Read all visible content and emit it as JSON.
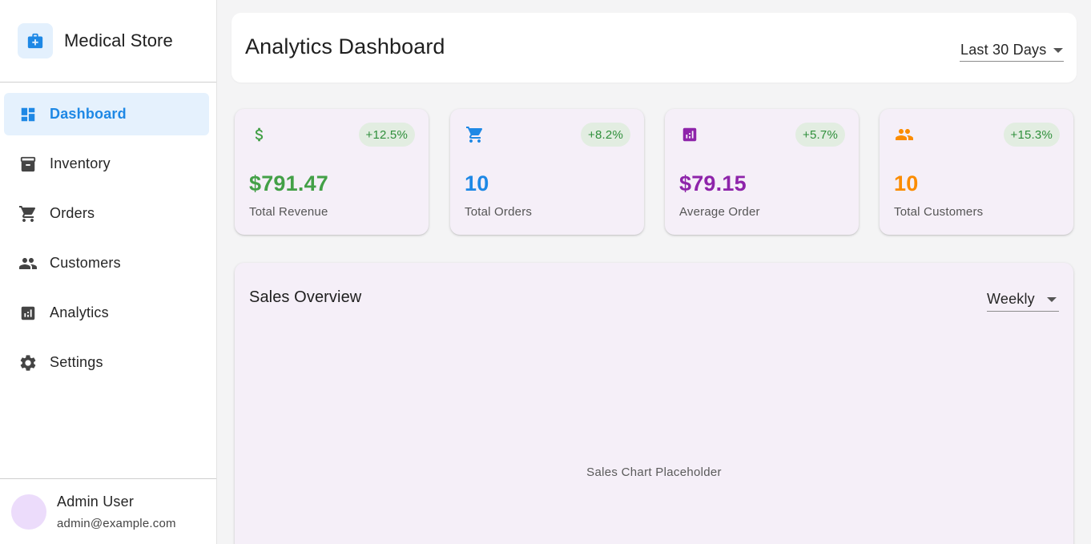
{
  "brand": {
    "title": "Medical Store",
    "icon": "medical-bag-icon"
  },
  "sidebar": {
    "items": [
      {
        "label": "Dashboard",
        "icon": "dashboard-icon",
        "active": true
      },
      {
        "label": "Inventory",
        "icon": "archive-icon"
      },
      {
        "label": "Orders",
        "icon": "cart-icon"
      },
      {
        "label": "Customers",
        "icon": "people-icon"
      },
      {
        "label": "Analytics",
        "icon": "analytics-icon"
      },
      {
        "label": "Settings",
        "icon": "gear-icon"
      }
    ]
  },
  "user": {
    "name": "Admin User",
    "email": "admin@example.com"
  },
  "header": {
    "title": "Analytics Dashboard",
    "range": "Last 30 Days"
  },
  "stats": [
    {
      "value": "$791.47",
      "label": "Total Revenue",
      "change": "+12.5%",
      "icon": "dollar-icon",
      "color": "#43a047"
    },
    {
      "value": "10",
      "label": "Total Orders",
      "change": "+8.2%",
      "icon": "cart-icon",
      "color": "#1e88e5"
    },
    {
      "value": "$79.15",
      "label": "Average Order",
      "change": "+5.7%",
      "icon": "analytics-icon",
      "color": "#8e24aa"
    },
    {
      "value": "10",
      "label": "Total Customers",
      "change": "+15.3%",
      "icon": "people-icon",
      "color": "#fb8c00"
    }
  ],
  "sales": {
    "title": "Sales Overview",
    "period": "Weekly",
    "placeholder": "Sales Chart Placeholder"
  },
  "colors": {
    "accent": "#1e88e5",
    "badge_bg": "#e2ede1",
    "badge_text": "#2f8f3b",
    "card_bg": "#f5eff8"
  }
}
